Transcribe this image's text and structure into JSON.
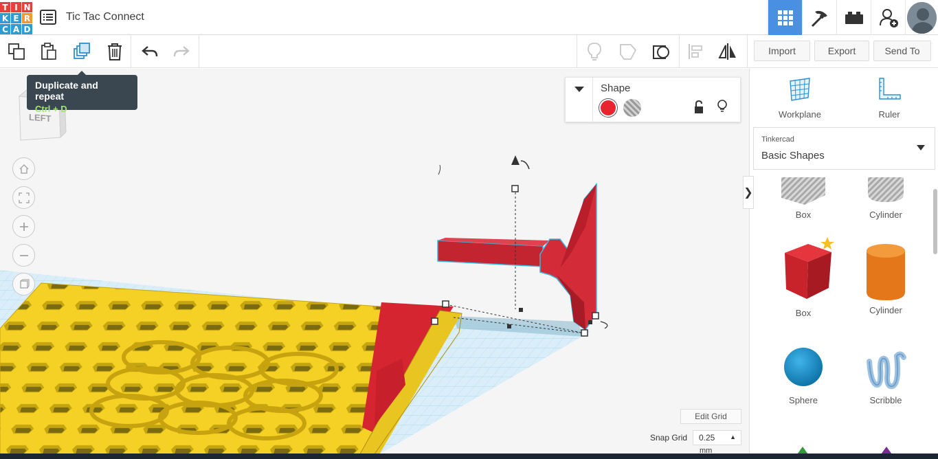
{
  "brand": {
    "logo_letters": [
      "T",
      "I",
      "N",
      "K",
      "E",
      "R",
      "C",
      "A",
      "D"
    ],
    "logo_colors": [
      "#e5403a",
      "#e5403a",
      "#e5403a",
      "#2c9bd6",
      "#2c9bd6",
      "#f39a2c",
      "#2c9bd6",
      "#2c9bd6",
      "#2c9bd6"
    ]
  },
  "header": {
    "design_title": "Tic Tac Connect",
    "icons": [
      "grid-view-icon",
      "pickaxe-icon",
      "bricks-icon",
      "add-user-icon",
      "profile-avatar"
    ]
  },
  "toolbar": {
    "tooltip": {
      "title": "Duplicate and repeat",
      "shortcut": "Ctrl + D"
    },
    "import_label": "Import",
    "export_label": "Export",
    "send_to_label": "Send To"
  },
  "viewcube": {
    "face_label": "LEFT"
  },
  "shape_panel": {
    "title": "Shape",
    "solid_color": "#e8242e"
  },
  "grid_controls": {
    "edit_grid_label": "Edit Grid",
    "snap_grid_label": "Snap Grid",
    "snap_value": "0.25",
    "snap_unit": "mm"
  },
  "right_panel": {
    "workplane_label": "Workplane",
    "ruler_label": "Ruler",
    "library_source": "Tinkercad",
    "library_name": "Basic Shapes",
    "shapes": [
      {
        "label": "Box",
        "icon": "box-hole-icon"
      },
      {
        "label": "Cylinder",
        "icon": "cylinder-hole-icon"
      },
      {
        "label": "Box",
        "icon": "box-icon"
      },
      {
        "label": "Cylinder",
        "icon": "cylinder-icon"
      },
      {
        "label": "Sphere",
        "icon": "sphere-icon"
      },
      {
        "label": "Scribble",
        "icon": "scribble-icon"
      }
    ]
  }
}
